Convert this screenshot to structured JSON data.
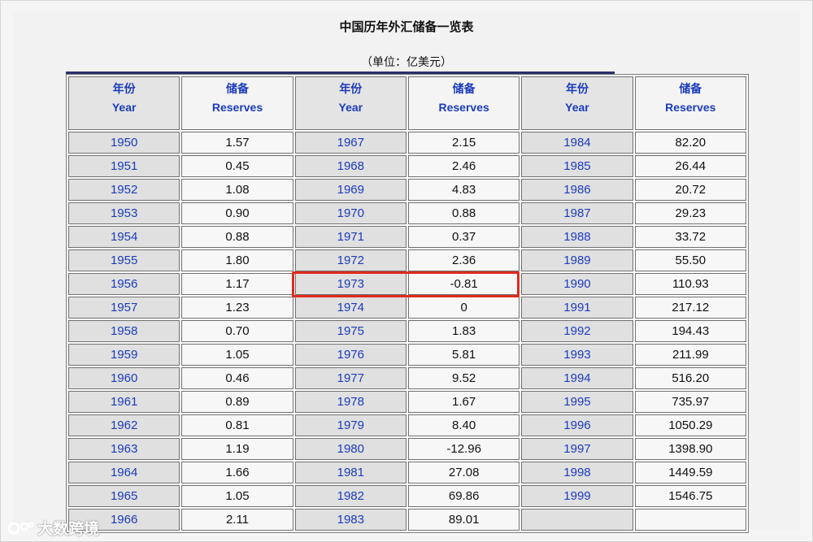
{
  "title": "中国历年外汇储备一览表",
  "unit": "（单位：亿美元）",
  "headers": {
    "year_cn": "年份",
    "year_en": "Year",
    "reserves_cn": "储备",
    "reserves_en": "Reserves"
  },
  "rows": [
    [
      "1950",
      "1.57",
      "1967",
      "2.15",
      "1984",
      "82.20"
    ],
    [
      "1951",
      "0.45",
      "1968",
      "2.46",
      "1985",
      "26.44"
    ],
    [
      "1952",
      "1.08",
      "1969",
      "4.83",
      "1986",
      "20.72"
    ],
    [
      "1953",
      "0.90",
      "1970",
      "0.88",
      "1987",
      "29.23"
    ],
    [
      "1954",
      "0.88",
      "1971",
      "0.37",
      "1988",
      "33.72"
    ],
    [
      "1955",
      "1.80",
      "1972",
      "2.36",
      "1989",
      "55.50"
    ],
    [
      "1956",
      "1.17",
      "1973",
      "-0.81",
      "1990",
      "110.93"
    ],
    [
      "1957",
      "1.23",
      "1974",
      "0",
      "1991",
      "217.12"
    ],
    [
      "1958",
      "0.70",
      "1975",
      "1.83",
      "1992",
      "194.43"
    ],
    [
      "1959",
      "1.05",
      "1976",
      "5.81",
      "1993",
      "211.99"
    ],
    [
      "1960",
      "0.46",
      "1977",
      "9.52",
      "1994",
      "516.20"
    ],
    [
      "1961",
      "0.89",
      "1978",
      "1.67",
      "1995",
      "735.97"
    ],
    [
      "1962",
      "0.81",
      "1979",
      "8.40",
      "1996",
      "1050.29"
    ],
    [
      "1963",
      "1.19",
      "1980",
      "-12.96",
      "1997",
      "1398.90"
    ],
    [
      "1964",
      "1.66",
      "1981",
      "27.08",
      "1998",
      "1449.59"
    ],
    [
      "1965",
      "1.05",
      "1982",
      "69.86",
      "1999",
      "1546.75"
    ],
    [
      "1966",
      "2.11",
      "1983",
      "89.01",
      "",
      ""
    ]
  ],
  "highlighted_row": {
    "year": "1973",
    "reserves": "-0.81"
  },
  "watermark": "大数跨境",
  "colors": {
    "link_blue": "#1a3bbd",
    "highlight_red": "#e02a1d"
  }
}
